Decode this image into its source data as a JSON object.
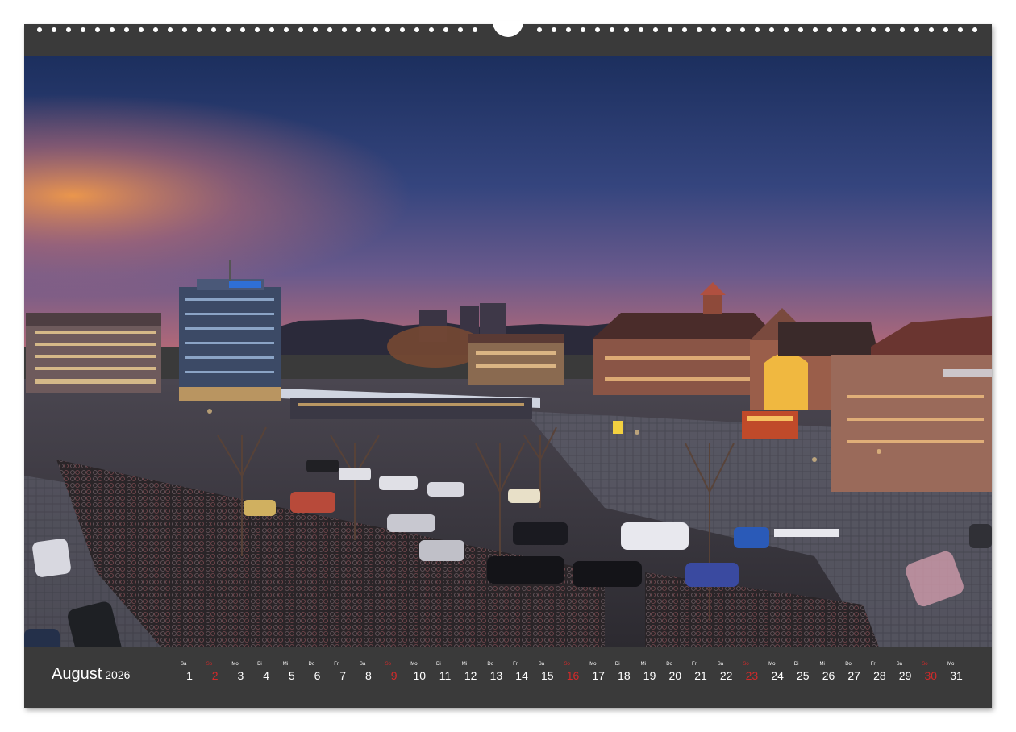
{
  "calendar": {
    "month": "August",
    "year": "2026",
    "days": [
      {
        "wd": "Sa",
        "n": "1",
        "sunday": false
      },
      {
        "wd": "So",
        "n": "2",
        "sunday": true
      },
      {
        "wd": "Mo",
        "n": "3",
        "sunday": false
      },
      {
        "wd": "Di",
        "n": "4",
        "sunday": false
      },
      {
        "wd": "Mi",
        "n": "5",
        "sunday": false
      },
      {
        "wd": "Do",
        "n": "6",
        "sunday": false
      },
      {
        "wd": "Fr",
        "n": "7",
        "sunday": false
      },
      {
        "wd": "Sa",
        "n": "8",
        "sunday": false
      },
      {
        "wd": "So",
        "n": "9",
        "sunday": true
      },
      {
        "wd": "Mo",
        "n": "10",
        "sunday": false
      },
      {
        "wd": "Di",
        "n": "11",
        "sunday": false
      },
      {
        "wd": "Mi",
        "n": "12",
        "sunday": false
      },
      {
        "wd": "Do",
        "n": "13",
        "sunday": false
      },
      {
        "wd": "Fr",
        "n": "14",
        "sunday": false
      },
      {
        "wd": "Sa",
        "n": "15",
        "sunday": false
      },
      {
        "wd": "So",
        "n": "16",
        "sunday": true
      },
      {
        "wd": "Mo",
        "n": "17",
        "sunday": false
      },
      {
        "wd": "Di",
        "n": "18",
        "sunday": false
      },
      {
        "wd": "Mi",
        "n": "19",
        "sunday": false
      },
      {
        "wd": "Do",
        "n": "20",
        "sunday": false
      },
      {
        "wd": "Fr",
        "n": "21",
        "sunday": false
      },
      {
        "wd": "Sa",
        "n": "22",
        "sunday": false
      },
      {
        "wd": "So",
        "n": "23",
        "sunday": true
      },
      {
        "wd": "Mo",
        "n": "24",
        "sunday": false
      },
      {
        "wd": "Di",
        "n": "25",
        "sunday": false
      },
      {
        "wd": "Mi",
        "n": "26",
        "sunday": false
      },
      {
        "wd": "Do",
        "n": "27",
        "sunday": false
      },
      {
        "wd": "Fr",
        "n": "28",
        "sunday": false
      },
      {
        "wd": "Sa",
        "n": "29",
        "sunday": false
      },
      {
        "wd": "So",
        "n": "30",
        "sunday": true
      },
      {
        "wd": "Mo",
        "n": "31",
        "sunday": false
      }
    ]
  },
  "colors": {
    "frame": "#3a3a3a",
    "sunday": "#d22a2a",
    "text": "#ffffff"
  }
}
